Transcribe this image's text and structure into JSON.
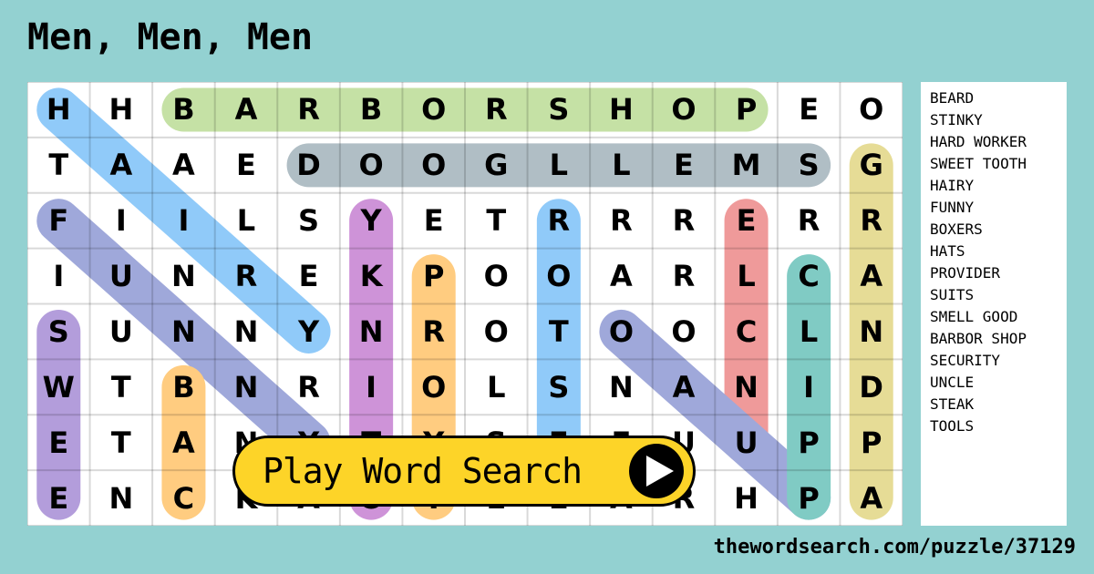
{
  "title": "Men, Men, Men",
  "grid": {
    "rows": [
      [
        "H",
        "H",
        "B",
        "A",
        "R",
        "B",
        "O",
        "R",
        "S",
        "H",
        "O",
        "P",
        "E",
        "O"
      ],
      [
        "T",
        "A",
        "A",
        "E",
        "D",
        "O",
        "O",
        "G",
        "L",
        "L",
        "E",
        "M",
        "S",
        "G"
      ],
      [
        "F",
        "I",
        "I",
        "L",
        "S",
        "Y",
        "E",
        "T",
        "R",
        "R",
        "R",
        "E",
        "R",
        "R"
      ],
      [
        "I",
        "U",
        "N",
        "R",
        "E",
        "K",
        "P",
        "O",
        "O",
        "A",
        "R",
        "L",
        "C",
        "A"
      ],
      [
        "S",
        "U",
        "N",
        "N",
        "Y",
        "N",
        "R",
        "O",
        "T",
        "O",
        "O",
        "C",
        "L",
        "N"
      ],
      [
        "W",
        "T",
        "B",
        "N",
        "R",
        "I",
        "O",
        "L",
        "S",
        "N",
        "A",
        "N",
        "I",
        "D"
      ],
      [
        "E",
        "T",
        "A",
        "N",
        "Y",
        "T",
        "Y",
        "S",
        "E",
        "E",
        "U",
        "U",
        "P",
        "P"
      ],
      [
        "E",
        "N",
        "C",
        "K",
        "A",
        "O",
        "Y",
        "E",
        "E",
        "A",
        "R",
        "H",
        "P",
        "A"
      ]
    ],
    "highlights": [
      {
        "word": "BARBOR SHOP",
        "from": [
          0,
          2
        ],
        "to": [
          0,
          11
        ],
        "color": "#c5e1a5"
      },
      {
        "word": "SMELL GOOD",
        "from": [
          1,
          4
        ],
        "to": [
          1,
          12
        ],
        "color": "#b0bec5"
      },
      {
        "word": "HAIRY",
        "from": [
          0,
          0
        ],
        "to": [
          4,
          4
        ],
        "color": "#90caf9"
      },
      {
        "word": "FUNNY",
        "from": [
          2,
          0
        ],
        "to": [
          6,
          4
        ],
        "color": "#9fa8da"
      },
      {
        "word": "STINKY",
        "from": [
          2,
          5
        ],
        "to": [
          7,
          5
        ],
        "color": "#ce93d8"
      },
      {
        "word": "PROVIDER",
        "from": [
          3,
          6
        ],
        "to": [
          7,
          6
        ],
        "color": "#ffcc80"
      },
      {
        "word": "TOOLS",
        "from": [
          2,
          8
        ],
        "to": [
          6,
          8
        ],
        "color": "#90caf9"
      },
      {
        "word": "UNCLE",
        "from": [
          2,
          11
        ],
        "to": [
          6,
          11
        ],
        "color": "#ef9a9a"
      },
      {
        "word": "SWEET TOOTH",
        "from": [
          4,
          9
        ],
        "to": [
          7,
          12
        ],
        "color": "#9fa8da"
      },
      {
        "word": "SECURITY",
        "from": [
          4,
          0
        ],
        "to": [
          7,
          0
        ],
        "color": "#b39ddb"
      },
      {
        "word": "BEARD",
        "from": [
          5,
          2
        ],
        "to": [
          7,
          2
        ],
        "color": "#ffcc80"
      },
      {
        "word": "CLIPP",
        "from": [
          3,
          12
        ],
        "to": [
          7,
          12
        ],
        "color": "#80cbc4"
      },
      {
        "word": "GRANDPA",
        "from": [
          1,
          13
        ],
        "to": [
          7,
          13
        ],
        "color": "#e6dc96"
      }
    ]
  },
  "word_list": [
    "BEARD",
    "STINKY",
    "HARD WORKER",
    "SWEET TOOTH",
    "HAIRY",
    "FUNNY",
    "BOXERS",
    "HATS",
    "PROVIDER",
    "SUITS",
    "SMELL GOOD",
    "BARBOR SHOP",
    "SECURITY",
    "UNCLE",
    "STEAK",
    "TOOLS"
  ],
  "play_button": {
    "label": "Play Word Search",
    "icon": "play-icon"
  },
  "footer": "thewordsearch.com/puzzle/37129"
}
